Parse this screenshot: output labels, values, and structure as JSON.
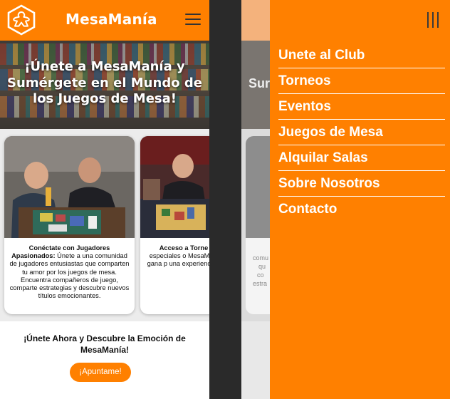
{
  "app": {
    "brand": "MesaManía"
  },
  "hero": {
    "title": "¡Únete a MesaManía y Sumérgete en el Mundo de los Juegos de Mesa!"
  },
  "cards": [
    {
      "title": "Conéctate con Jugadores Apasionados:",
      "body": "Únete a una comunidad de jugadores entusiastas que comparten tu amor por los juegos de mesa. Encuentra compañeros de juego, comparte estrategias y descubre nuevos títulos emocionantes."
    },
    {
      "title": "Acceso a Torne",
      "body": "torneos emoci especiales o MesaManía. habilidades, gana p una experiencia aficionados a lo"
    }
  ],
  "cta": {
    "title": "¡Únete Ahora y Descubre la Emoción de MesaManía!",
    "button": "¡Apuntame!"
  },
  "menu": {
    "items": [
      "Unete al Club",
      "Torneos",
      "Eventos",
      "Juegos de Mesa",
      "Alquilar Salas",
      "Sobre Nosotros",
      "Contacto"
    ]
  },
  "peek": {
    "hero_fragment": "Sur",
    "card_lines": [
      "comu",
      "qu",
      "co",
      "estra"
    ]
  },
  "colors": {
    "accent": "#ff8000",
    "header_text": "#ffffff",
    "menu_text": "#ffffff"
  },
  "icons": {
    "logo": "meeple-logo-icon",
    "menu": "hamburger-menu-icon",
    "close": "vertical-bars-close-icon"
  }
}
